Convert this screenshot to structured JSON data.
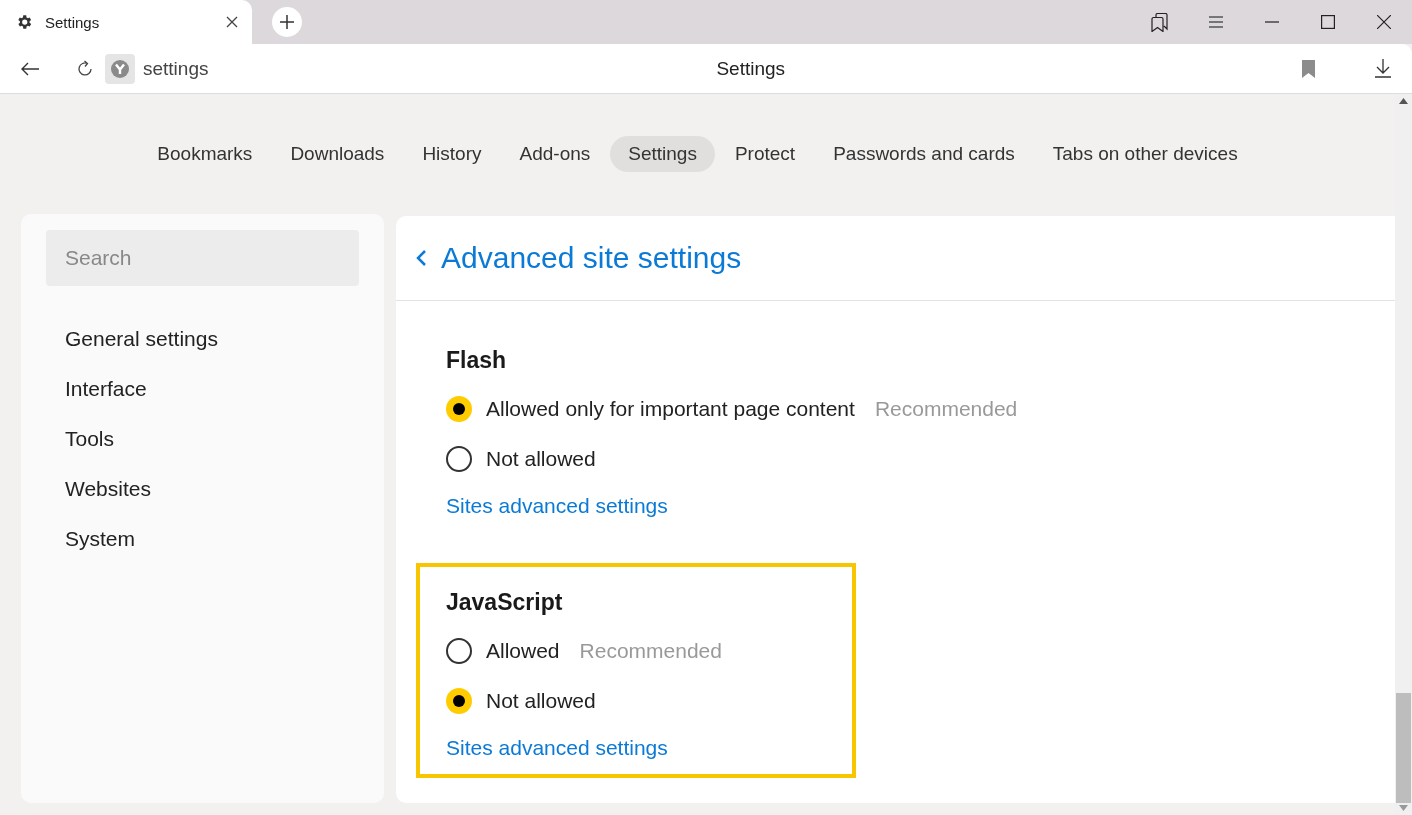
{
  "browser_tab": {
    "title": "Settings",
    "selected": true
  },
  "address_bar": {
    "url": "settings",
    "page_title": "Settings"
  },
  "nav_tabs": [
    {
      "label": "Bookmarks",
      "selected": false
    },
    {
      "label": "Downloads",
      "selected": false
    },
    {
      "label": "History",
      "selected": false
    },
    {
      "label": "Add-ons",
      "selected": false
    },
    {
      "label": "Settings",
      "selected": true
    },
    {
      "label": "Protect",
      "selected": false
    },
    {
      "label": "Passwords and cards",
      "selected": false
    },
    {
      "label": "Tabs on other devices",
      "selected": false
    }
  ],
  "sidebar": {
    "search": {
      "placeholder": "Search"
    },
    "items": [
      {
        "label": "General settings"
      },
      {
        "label": "Interface"
      },
      {
        "label": "Tools"
      },
      {
        "label": "Websites"
      },
      {
        "label": "System"
      }
    ]
  },
  "main": {
    "title": "Advanced site settings",
    "sections": [
      {
        "title": "Flash",
        "highlighted": false,
        "options": [
          {
            "label": "Allowed only for important page content",
            "note": "Recommended",
            "selected": true
          },
          {
            "label": "Not allowed",
            "selected": false
          }
        ],
        "link": "Sites advanced settings"
      },
      {
        "title": "JavaScript",
        "highlighted": true,
        "options": [
          {
            "label": "Allowed",
            "note": "Recommended",
            "selected": false
          },
          {
            "label": "Not allowed",
            "selected": true
          }
        ],
        "link": "Sites advanced settings"
      }
    ]
  }
}
